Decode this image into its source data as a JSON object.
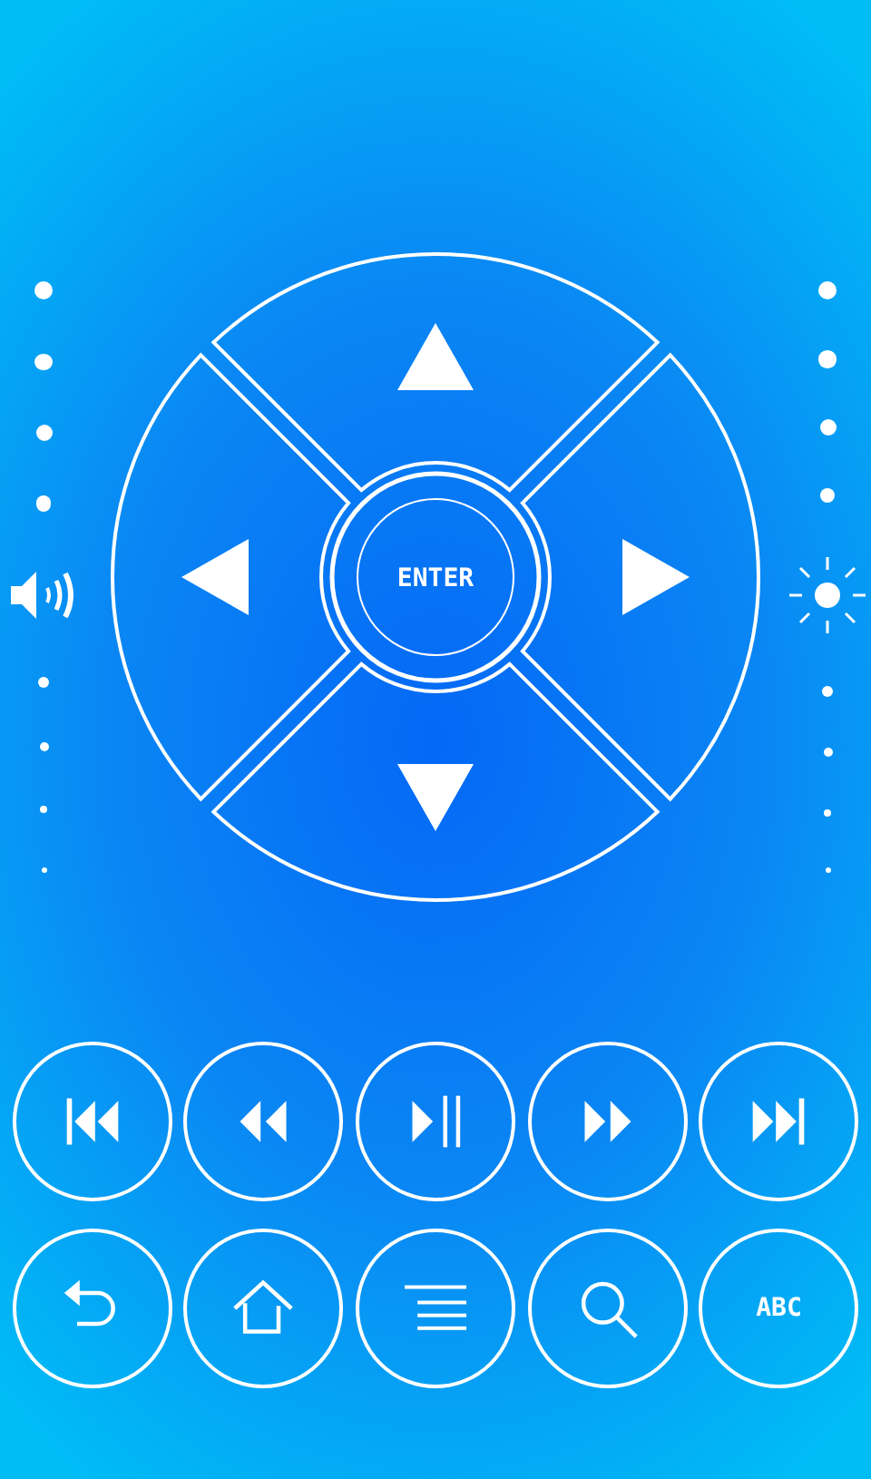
{
  "dpad": {
    "directions": [
      {
        "kind": "up"
      },
      {
        "kind": "left"
      },
      {
        "kind": "right"
      },
      {
        "kind": "down"
      }
    ],
    "enter": {
      "label": "ENTER"
    }
  },
  "media_buttons": [
    {
      "kind": "previous"
    },
    {
      "kind": "rewind"
    },
    {
      "kind": "play_pause"
    },
    {
      "kind": "forward"
    },
    {
      "kind": "next"
    }
  ],
  "nav_buttons": [
    {
      "kind": "back"
    },
    {
      "kind": "home"
    },
    {
      "kind": "menu"
    },
    {
      "kind": "search"
    },
    {
      "kind": "keyboard",
      "label": "ABC"
    }
  ]
}
